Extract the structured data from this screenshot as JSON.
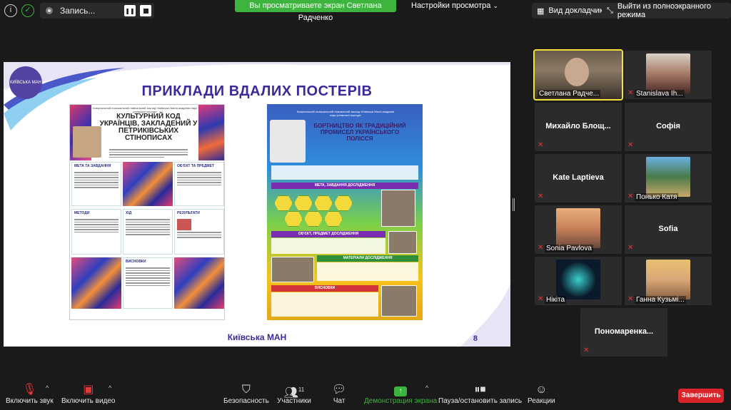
{
  "top_bar": {
    "recording_label": "Запись...",
    "share_banner": "Вы просматриваете экран Светлана Радченко",
    "view_options": "Настройки просмотра",
    "speaker_view": "Вид докладчика",
    "exit_fullscreen": "Выйти из полноэкранного режима"
  },
  "slide": {
    "title": "ПРИКЛАДИ ВДАЛИХ ПОСТЕРІВ",
    "footer": "Київська МАН",
    "page_number": "8",
    "logo_text": "КИЇВСЬКА МАН",
    "poster1": {
      "header": "Комунальний позашкільний навчальний заклад «Київська Мала академія наук учнівської молоді»",
      "title": "КУЛЬТУРНИЙ КОД УКРАЇНЦІВ, ЗАКЛАДЕНИЙ У ПЕТРИКІВСЬКИХ СТІНОПИСАХ",
      "sections": [
        "МЕТА ТА ЗАВДАННЯ",
        "ОБ'ЄКТ ТА ПРЕДМЕТ",
        "МЕТОДИ",
        "ХІД",
        "РЕЗУЛЬТАТИ",
        "ВИСНОВКИ"
      ]
    },
    "poster2": {
      "header": "Комунальний позашкільний навчальний заклад «Київська Мала академія наук учнівської молоді»",
      "title": "БОРТНИЦТВО ЯК ТРАДИЦІЙНИЙ ПРОМИСЕЛ УКРАЇНСЬКОГО ПОЛІССЯ",
      "sections": [
        "МЕТА, ЗАВДАННЯ ДОСЛІДЖЕННЯ",
        "ОБ'ЄКТ, ПРЕДМЕТ ДОСЛІДЖЕННЯ",
        "МАТЕРІАЛИ ДОСЛІДЖЕННЯ",
        "ВИСНОВКИ"
      ]
    }
  },
  "participants": [
    {
      "name": "Светлана Радче...",
      "video": true,
      "active": true,
      "muted": false
    },
    {
      "name": "Stanislava Ih...",
      "video": true,
      "active": false,
      "muted": true
    },
    {
      "name": "Михайло  Блощ...",
      "video": false,
      "muted": true
    },
    {
      "name": "Софія",
      "video": false,
      "muted": true
    },
    {
      "name": "Kate Laptieva",
      "video": false,
      "muted": true
    },
    {
      "name": "Понько Катя",
      "video": true,
      "muted": true
    },
    {
      "name": "Sonia Pavlova",
      "video": true,
      "muted": true
    },
    {
      "name": "Sofia",
      "video": false,
      "muted": true
    },
    {
      "name": "Нікіта",
      "video": true,
      "muted": true
    },
    {
      "name": "Ганна Кузьмі...",
      "video": true,
      "muted": true
    },
    {
      "name": "Пономаренка...",
      "video": false,
      "muted": true
    }
  ],
  "toolbar": {
    "mute": "Включить звук",
    "video": "Включить видео",
    "security": "Безопасность",
    "participants": "Участники",
    "participants_count": "11",
    "chat": "Чат",
    "share": "Демонстрация экрана",
    "pause_recording": "Пауза/остановить запись",
    "reactions": "Реакции",
    "end": "Завершить"
  },
  "colors": {
    "share_green": "#3db43d",
    "end_red": "#d9252a",
    "active_speaker": "#f2e23a",
    "slide_title": "#3b2a9a"
  }
}
